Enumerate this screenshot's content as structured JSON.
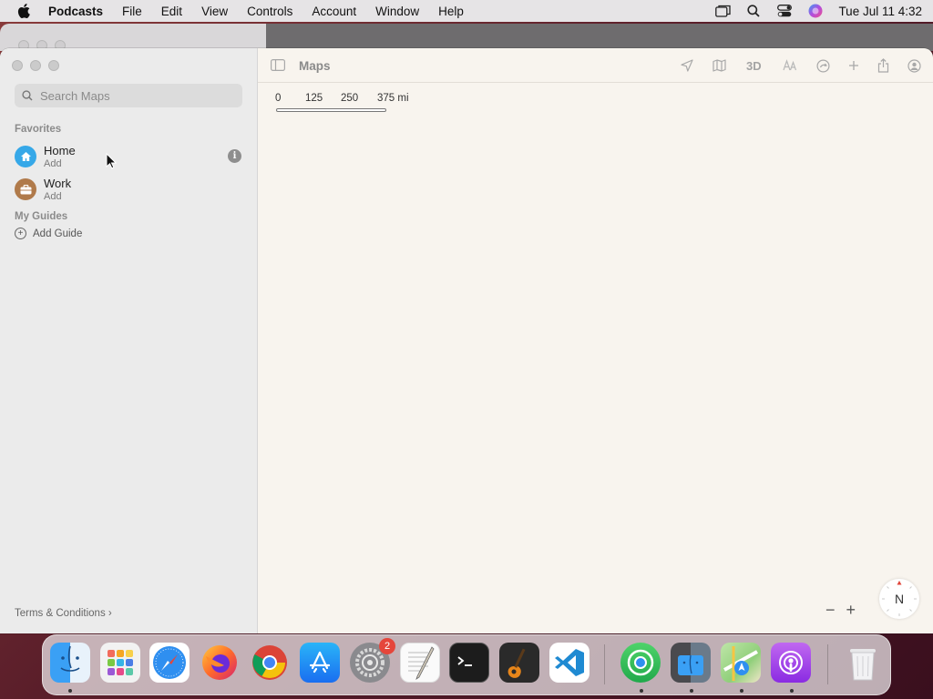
{
  "menubar": {
    "app": "Podcasts",
    "items": [
      "File",
      "Edit",
      "View",
      "Controls",
      "Account",
      "Window",
      "Help"
    ],
    "clock": "Tue Jul 11  4:32",
    "status_icons": [
      "window-switch-icon",
      "spotlight-search-icon",
      "control-center-icon",
      "siri-icon"
    ]
  },
  "window": {
    "title": "Maps",
    "search_placeholder": "Search Maps",
    "favorites_header": "Favorites",
    "favorites": [
      {
        "name": "Home",
        "sub": "Add",
        "color": "#36a8e8",
        "icon": "house-icon"
      },
      {
        "name": "Work",
        "sub": "Add",
        "color": "#b07a4a",
        "icon": "briefcase-icon"
      }
    ],
    "guides_header": "My Guides",
    "add_guide": "Add Guide",
    "terms": "Terms & Conditions",
    "toolbar": {
      "three_d": "3D",
      "icons": [
        "sidebar-toggle-icon",
        "location-icon",
        "map-mode-icon",
        "3d-toggle",
        "translate-icon",
        "look-around-icon",
        "add-icon",
        "share-icon",
        "account-icon"
      ]
    },
    "scale": {
      "labels": [
        "0",
        "125",
        "250",
        "375 mi"
      ]
    },
    "zoom_out": "−",
    "zoom_in": "+",
    "compass": "N"
  },
  "dock": {
    "apps": [
      "Finder",
      "Launchpad",
      "Safari",
      "Firefox",
      "Chrome",
      "App Store",
      "System Settings",
      "TextEdit",
      "Terminal",
      "GarageBand",
      "VS Code",
      "Find My",
      "Preview",
      "Maps",
      "Podcasts",
      "Trash"
    ],
    "settings_badge": "2"
  }
}
